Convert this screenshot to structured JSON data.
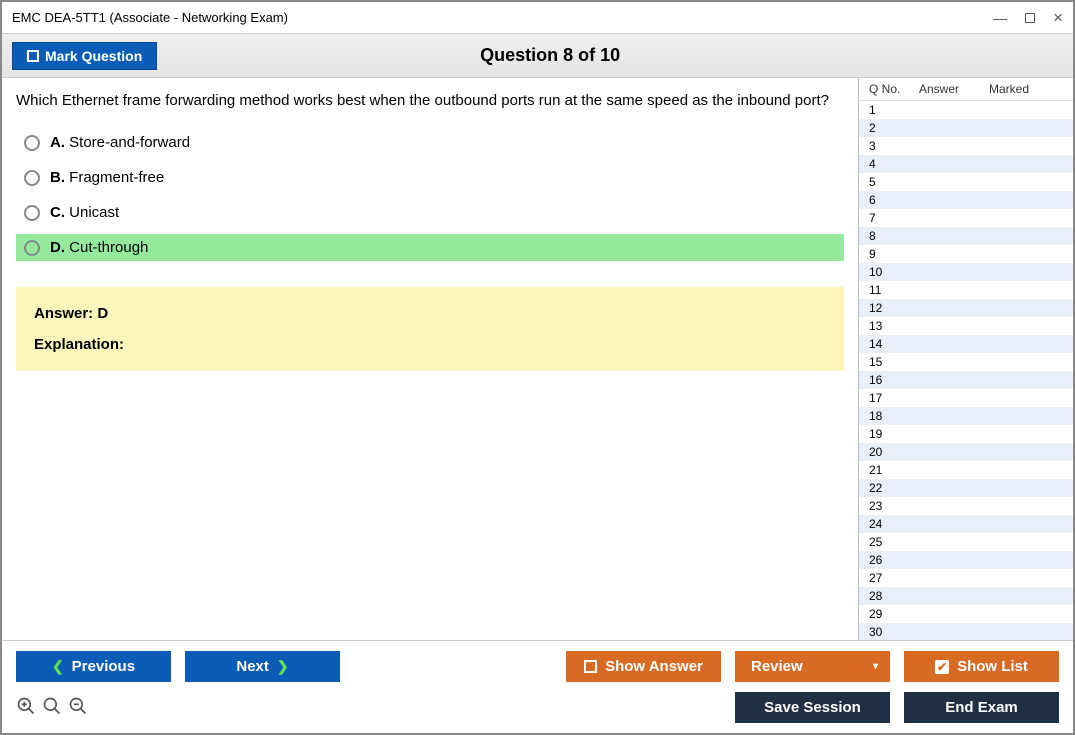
{
  "window": {
    "title": "EMC DEA-5TT1 (Associate - Networking Exam)"
  },
  "header": {
    "mark_label": "Mark Question",
    "question_heading": "Question 8 of 10"
  },
  "question": {
    "text": "Which Ethernet frame forwarding method works best when the outbound ports run at the same speed as the inbound port?",
    "options": [
      {
        "letter": "A.",
        "text": "Store-and-forward",
        "correct": false
      },
      {
        "letter": "B.",
        "text": "Fragment-free",
        "correct": false
      },
      {
        "letter": "C.",
        "text": "Unicast",
        "correct": false
      },
      {
        "letter": "D.",
        "text": "Cut-through",
        "correct": true
      }
    ],
    "answer_line": "Answer: D",
    "explanation_label": "Explanation:"
  },
  "sidebar": {
    "cols": {
      "qno": "Q No.",
      "answer": "Answer",
      "marked": "Marked"
    },
    "rows": [
      {
        "n": "1"
      },
      {
        "n": "2"
      },
      {
        "n": "3"
      },
      {
        "n": "4"
      },
      {
        "n": "5"
      },
      {
        "n": "6"
      },
      {
        "n": "7"
      },
      {
        "n": "8"
      },
      {
        "n": "9"
      },
      {
        "n": "10"
      },
      {
        "n": "11"
      },
      {
        "n": "12"
      },
      {
        "n": "13"
      },
      {
        "n": "14"
      },
      {
        "n": "15"
      },
      {
        "n": "16"
      },
      {
        "n": "17"
      },
      {
        "n": "18"
      },
      {
        "n": "19"
      },
      {
        "n": "20"
      },
      {
        "n": "21"
      },
      {
        "n": "22"
      },
      {
        "n": "23"
      },
      {
        "n": "24"
      },
      {
        "n": "25"
      },
      {
        "n": "26"
      },
      {
        "n": "27"
      },
      {
        "n": "28"
      },
      {
        "n": "29"
      },
      {
        "n": "30"
      }
    ]
  },
  "bottom": {
    "previous": "Previous",
    "next": "Next",
    "show_answer": "Show Answer",
    "review": "Review",
    "show_list": "Show List",
    "save_session": "Save Session",
    "end_exam": "End Exam"
  }
}
